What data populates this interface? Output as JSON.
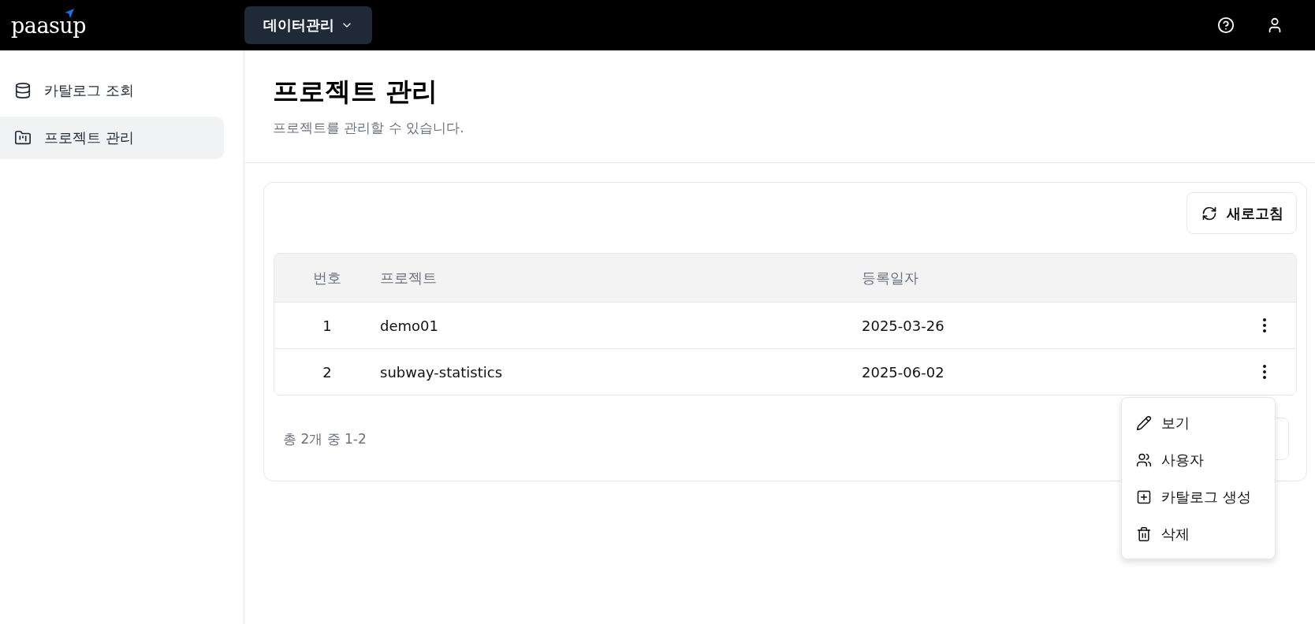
{
  "topbar": {
    "logo": "paasup",
    "menu_button": "데이터관리"
  },
  "sidebar": {
    "items": [
      {
        "label": "카탈로그 조회",
        "selected": false
      },
      {
        "label": "프로젝트 관리",
        "selected": true
      }
    ]
  },
  "page": {
    "title": "프로젝트 관리",
    "subtitle": "프로젝트를 관리할 수 있습니다."
  },
  "toolbar": {
    "refresh_button": "새로고침"
  },
  "table": {
    "columns": [
      "번호",
      "프로젝트",
      "등록일자"
    ],
    "rows": [
      {
        "number": "1",
        "project": "demo01",
        "date": "2025-03-26"
      },
      {
        "number": "2",
        "project": "subway-statistics",
        "date": "2025-06-02"
      }
    ]
  },
  "pagination": {
    "summary": "총 2개 중 1-2"
  },
  "context_menu": {
    "items": [
      {
        "label": "보기"
      },
      {
        "label": "사용자"
      },
      {
        "label": "카탈로그 생성"
      },
      {
        "label": "삭제"
      }
    ]
  }
}
